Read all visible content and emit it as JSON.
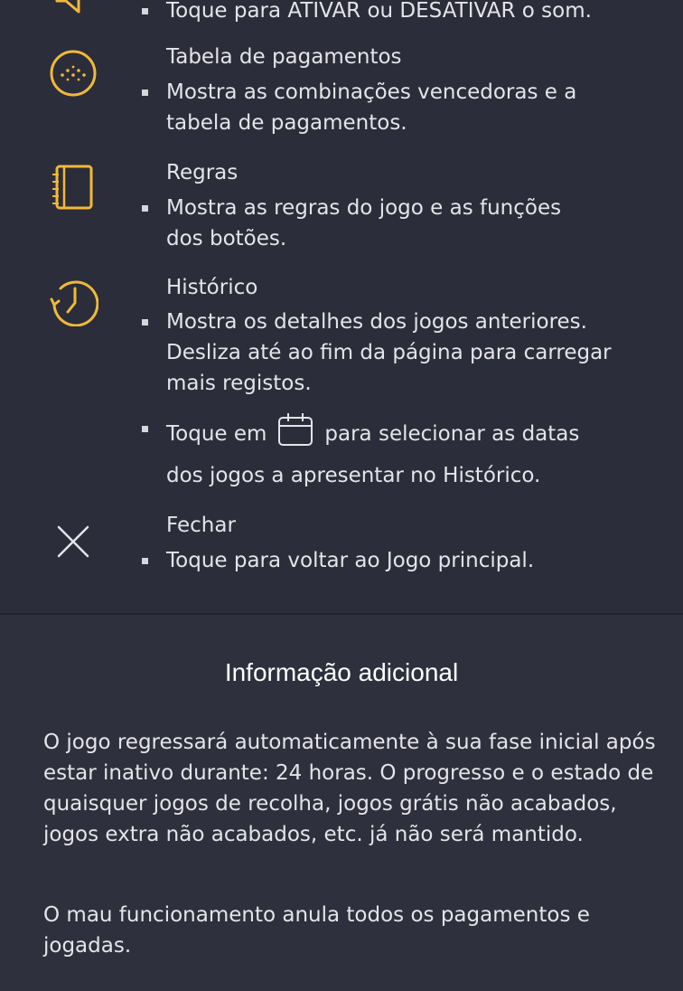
{
  "accent_color": "#f0b93a",
  "items": [
    {
      "icon": "speaker-icon",
      "title": "",
      "bullets": [
        "Toque para ATIVAR ou DESATIVAR o som."
      ]
    },
    {
      "icon": "paytable-icon",
      "title": "Tabela de pagamentos",
      "bullets": [
        "Mostra as combinações vencedoras e a\ntabela de pagamentos."
      ]
    },
    {
      "icon": "notebook-icon",
      "title": "Regras",
      "bullets": [
        "Mostra as regras do jogo e as funções\ndos botões."
      ]
    },
    {
      "icon": "history-clock-icon",
      "title": "Histórico",
      "bullets": [
        "Mostra os detalhes dos jogos anteriores.\nDesliza até ao fim da página para carregar\nmais registos.",
        "Toque em",
        "para selecionar as datas",
        "dos jogos a apresentar no Histórico."
      ]
    },
    {
      "icon": "close-icon",
      "title": "Fechar",
      "bullets": [
        "Toque para voltar ao Jogo principal."
      ]
    }
  ],
  "additional": {
    "title": "Informação adicional",
    "paragraphs": [
      "O jogo regressará automaticamente à sua fase inicial após estar inativo durante: 24 horas. O progresso e o estado de quaisquer jogos de recolha, jogos grátis não acabados, jogos extra não acabados, etc. já não será mantido.",
      "O mau funcionamento anula todos os pagamentos e jogadas."
    ]
  }
}
